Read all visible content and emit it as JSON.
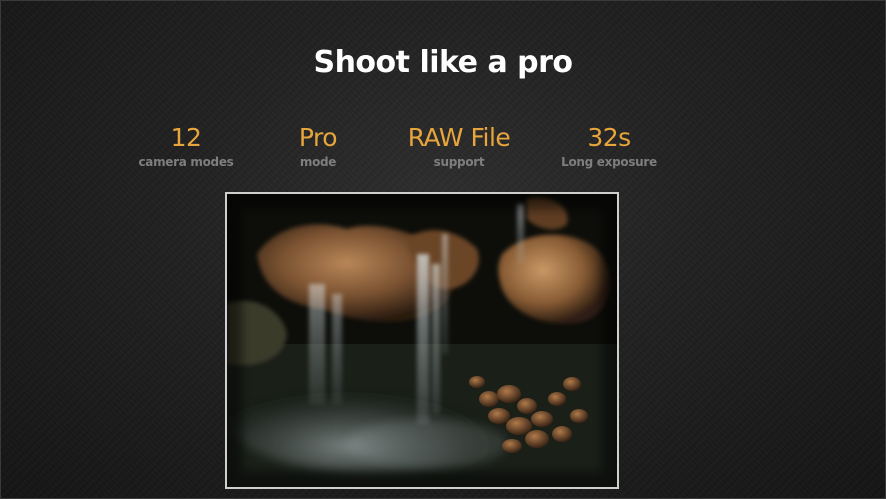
{
  "slide": {
    "title": "Shoot like a pro",
    "accent_color": "#e7a53c",
    "stats": [
      {
        "value": "12",
        "label": "camera modes"
      },
      {
        "value": "Pro",
        "label": "mode"
      },
      {
        "value": "RAW File",
        "label": "support"
      },
      {
        "value": "32s",
        "label": "Long exposure"
      }
    ],
    "photo": {
      "subject": "long exposure waterfall over rocks"
    }
  }
}
